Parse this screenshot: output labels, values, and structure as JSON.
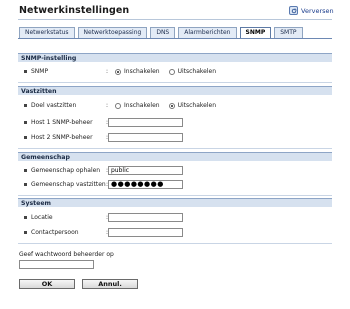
{
  "header": {
    "title": "Netwerkinstellingen",
    "refresh_label": "Verversen"
  },
  "tabs": [
    {
      "label": "Netwerkstatus"
    },
    {
      "label": "Netwerktoepassing"
    },
    {
      "label": "DNS"
    },
    {
      "label": "Alarmberichten"
    },
    {
      "label": "SNMP",
      "active": true
    },
    {
      "label": "SMTP"
    }
  ],
  "sections": {
    "snmp": {
      "title": "SNMP-instelling",
      "snmp_label": "SNMP",
      "options": [
        "Inschakelen",
        "Uitschakelen"
      ],
      "selected": "Inschakelen"
    },
    "traps": {
      "title": "Vastzitten",
      "doel_label": "Doel vastzitten",
      "options": [
        "Inschakelen",
        "Uitschakelen"
      ],
      "selected": "Uitschakelen",
      "host1_label": "Host 1 SNMP-beheer",
      "host1_value": "",
      "host2_label": "Host 2 SNMP-beheer",
      "host2_value": ""
    },
    "community": {
      "title": "Gemeenschap",
      "get_label": "Gemeenschap ophalen",
      "get_value": "public",
      "set_label": "Gemeenschap vastzitten",
      "set_value": "●●●●●●●●"
    },
    "system": {
      "title": "Systeem",
      "location_label": "Locatie",
      "location_value": "",
      "contact_label": "Contactpersoon",
      "contact_value": ""
    }
  },
  "admin": {
    "label": "Geef wachtwoord beheerder op",
    "value": ""
  },
  "buttons": {
    "ok": "OK",
    "cancel": "Annul."
  },
  "colon": ":"
}
